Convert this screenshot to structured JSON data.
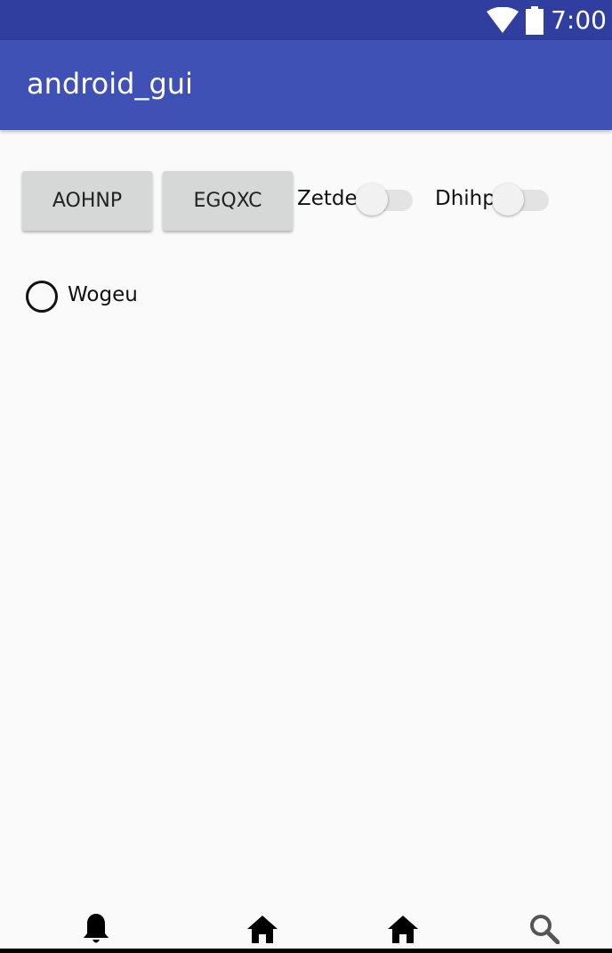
{
  "status_bar": {
    "time": "7:00",
    "icons": [
      "wifi-icon",
      "battery-icon"
    ],
    "color": "#303f9f"
  },
  "app_bar": {
    "title": "android_gui",
    "color": "#3f51b5"
  },
  "buttons": [
    {
      "label": "AOHNP"
    },
    {
      "label": "EGQXC"
    }
  ],
  "switches": [
    {
      "label": "Zetde",
      "checked": false
    },
    {
      "label": "Dhihp",
      "checked": false
    }
  ],
  "radio": {
    "label": "Wogeu",
    "checked": false
  },
  "bottom_nav": {
    "items": [
      {
        "icon": "bell-icon"
      },
      {
        "icon": "home-icon"
      },
      {
        "icon": "home-icon"
      },
      {
        "icon": "search-icon"
      }
    ]
  }
}
